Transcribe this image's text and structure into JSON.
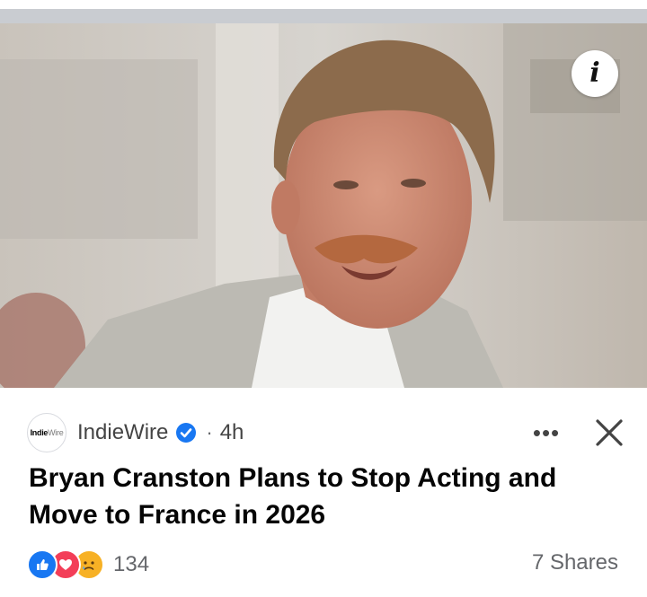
{
  "post": {
    "source_name": "IndieWire",
    "logo_text_a": "Indie",
    "logo_text_b": "Wire",
    "time": "4h",
    "separator": "·",
    "more_label": "•••",
    "headline": "Bryan Cranston Plans to Stop Acting and Move to France in 2026",
    "reaction_count": "134",
    "shares": "7 Shares",
    "info_label": "i"
  },
  "icons": {
    "info": "info-icon",
    "verified": "verified-badge-icon",
    "close": "close-icon",
    "like": "like-reaction-icon",
    "love": "love-reaction-icon",
    "sad": "sad-reaction-icon"
  },
  "colors": {
    "accent": "#1877f2",
    "love": "#f33e58",
    "sad": "#f7b125",
    "secondary_text": "#65676b"
  }
}
